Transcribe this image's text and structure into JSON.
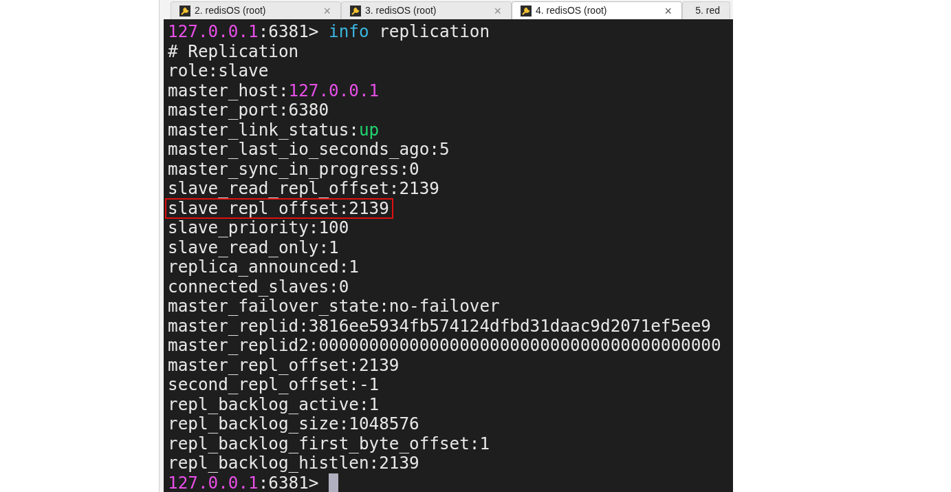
{
  "tabs": [
    {
      "label": "2. redisOS (root)",
      "close": "×",
      "selected": false
    },
    {
      "label": "3. redisOS (root)",
      "close": "×",
      "selected": false
    },
    {
      "label": "4. redisOS (root)",
      "close": "×",
      "selected": true
    },
    {
      "label": "5. red",
      "selected": false
    }
  ],
  "terminal": {
    "lines": [
      {
        "segments": [
          {
            "text": "127.0.0.1",
            "color": "#e84fe8"
          },
          {
            "text": ":6381> ",
            "color": "#e8e8e8"
          },
          {
            "text": "info",
            "color": "#3bb6e0"
          },
          {
            "text": " replication",
            "color": "#e8e8e8"
          }
        ]
      },
      {
        "segments": [
          {
            "text": "# Replication",
            "color": "#e8e8e8"
          }
        ]
      },
      {
        "segments": [
          {
            "text": "role:slave",
            "color": "#e8e8e8"
          }
        ]
      },
      {
        "segments": [
          {
            "text": "master_host:",
            "color": "#e8e8e8"
          },
          {
            "text": "127.0.0.1",
            "color": "#e84fe8"
          }
        ]
      },
      {
        "segments": [
          {
            "text": "master_port:6380",
            "color": "#e8e8e8"
          }
        ]
      },
      {
        "segments": [
          {
            "text": "master_link_status:",
            "color": "#e8e8e8"
          },
          {
            "text": "up",
            "color": "#22d36f"
          }
        ]
      },
      {
        "segments": [
          {
            "text": "master_last_io_seconds_ago:5",
            "color": "#e8e8e8"
          }
        ]
      },
      {
        "segments": [
          {
            "text": "master_sync_in_progress:0",
            "color": "#e8e8e8"
          }
        ]
      },
      {
        "segments": [
          {
            "text": "slave_read_repl_offset:2139",
            "color": "#e8e8e8"
          }
        ]
      },
      {
        "highlighted": true,
        "segments": [
          {
            "text": "slave_repl_offset:2139",
            "color": "#e8e8e8"
          }
        ]
      },
      {
        "segments": [
          {
            "text": "slave_priority:100",
            "color": "#e8e8e8"
          }
        ]
      },
      {
        "segments": [
          {
            "text": "slave_read_only:1",
            "color": "#e8e8e8"
          }
        ]
      },
      {
        "segments": [
          {
            "text": "replica_announced:1",
            "color": "#e8e8e8"
          }
        ]
      },
      {
        "segments": [
          {
            "text": "connected_slaves:0",
            "color": "#e8e8e8"
          }
        ]
      },
      {
        "segments": [
          {
            "text": "master_failover_state:no-failover",
            "color": "#e8e8e8"
          }
        ]
      },
      {
        "segments": [
          {
            "text": "master_replid:3816ee5934fb574124dfbd31daac9d2071ef5ee9",
            "color": "#e8e8e8"
          }
        ]
      },
      {
        "segments": [
          {
            "text": "master_replid2:0000000000000000000000000000000000000000",
            "color": "#e8e8e8"
          }
        ]
      },
      {
        "segments": [
          {
            "text": "master_repl_offset:2139",
            "color": "#e8e8e8"
          }
        ]
      },
      {
        "segments": [
          {
            "text": "second_repl_offset:-1",
            "color": "#e8e8e8"
          }
        ]
      },
      {
        "segments": [
          {
            "text": "repl_backlog_active:1",
            "color": "#e8e8e8"
          }
        ]
      },
      {
        "segments": [
          {
            "text": "repl_backlog_size:1048576",
            "color": "#e8e8e8"
          }
        ]
      },
      {
        "segments": [
          {
            "text": "repl_backlog_first_byte_offset:1",
            "color": "#e8e8e8"
          }
        ]
      },
      {
        "segments": [
          {
            "text": "repl_backlog_histlen:2139",
            "color": "#e8e8e8"
          }
        ]
      },
      {
        "cursor": true,
        "segments": [
          {
            "text": "127.0.0.1",
            "color": "#e84fe8"
          },
          {
            "text": ":6381> ",
            "color": "#e8e8e8"
          }
        ]
      }
    ]
  }
}
